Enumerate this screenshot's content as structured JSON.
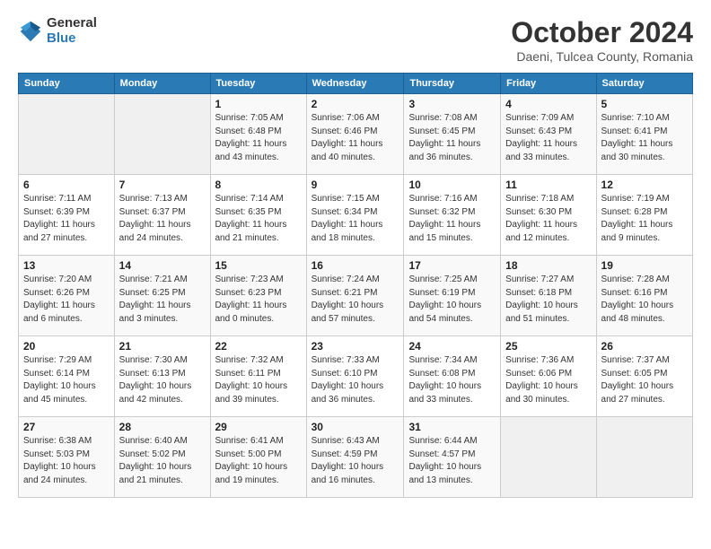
{
  "header": {
    "logo_general": "General",
    "logo_blue": "Blue",
    "month": "October 2024",
    "location": "Daeni, Tulcea County, Romania"
  },
  "weekdays": [
    "Sunday",
    "Monday",
    "Tuesday",
    "Wednesday",
    "Thursday",
    "Friday",
    "Saturday"
  ],
  "weeks": [
    [
      {
        "day": "",
        "sunrise": "",
        "sunset": "",
        "daylight": ""
      },
      {
        "day": "",
        "sunrise": "",
        "sunset": "",
        "daylight": ""
      },
      {
        "day": "1",
        "sunrise": "Sunrise: 7:05 AM",
        "sunset": "Sunset: 6:48 PM",
        "daylight": "Daylight: 11 hours and 43 minutes."
      },
      {
        "day": "2",
        "sunrise": "Sunrise: 7:06 AM",
        "sunset": "Sunset: 6:46 PM",
        "daylight": "Daylight: 11 hours and 40 minutes."
      },
      {
        "day": "3",
        "sunrise": "Sunrise: 7:08 AM",
        "sunset": "Sunset: 6:45 PM",
        "daylight": "Daylight: 11 hours and 36 minutes."
      },
      {
        "day": "4",
        "sunrise": "Sunrise: 7:09 AM",
        "sunset": "Sunset: 6:43 PM",
        "daylight": "Daylight: 11 hours and 33 minutes."
      },
      {
        "day": "5",
        "sunrise": "Sunrise: 7:10 AM",
        "sunset": "Sunset: 6:41 PM",
        "daylight": "Daylight: 11 hours and 30 minutes."
      }
    ],
    [
      {
        "day": "6",
        "sunrise": "Sunrise: 7:11 AM",
        "sunset": "Sunset: 6:39 PM",
        "daylight": "Daylight: 11 hours and 27 minutes."
      },
      {
        "day": "7",
        "sunrise": "Sunrise: 7:13 AM",
        "sunset": "Sunset: 6:37 PM",
        "daylight": "Daylight: 11 hours and 24 minutes."
      },
      {
        "day": "8",
        "sunrise": "Sunrise: 7:14 AM",
        "sunset": "Sunset: 6:35 PM",
        "daylight": "Daylight: 11 hours and 21 minutes."
      },
      {
        "day": "9",
        "sunrise": "Sunrise: 7:15 AM",
        "sunset": "Sunset: 6:34 PM",
        "daylight": "Daylight: 11 hours and 18 minutes."
      },
      {
        "day": "10",
        "sunrise": "Sunrise: 7:16 AM",
        "sunset": "Sunset: 6:32 PM",
        "daylight": "Daylight: 11 hours and 15 minutes."
      },
      {
        "day": "11",
        "sunrise": "Sunrise: 7:18 AM",
        "sunset": "Sunset: 6:30 PM",
        "daylight": "Daylight: 11 hours and 12 minutes."
      },
      {
        "day": "12",
        "sunrise": "Sunrise: 7:19 AM",
        "sunset": "Sunset: 6:28 PM",
        "daylight": "Daylight: 11 hours and 9 minutes."
      }
    ],
    [
      {
        "day": "13",
        "sunrise": "Sunrise: 7:20 AM",
        "sunset": "Sunset: 6:26 PM",
        "daylight": "Daylight: 11 hours and 6 minutes."
      },
      {
        "day": "14",
        "sunrise": "Sunrise: 7:21 AM",
        "sunset": "Sunset: 6:25 PM",
        "daylight": "Daylight: 11 hours and 3 minutes."
      },
      {
        "day": "15",
        "sunrise": "Sunrise: 7:23 AM",
        "sunset": "Sunset: 6:23 PM",
        "daylight": "Daylight: 11 hours and 0 minutes."
      },
      {
        "day": "16",
        "sunrise": "Sunrise: 7:24 AM",
        "sunset": "Sunset: 6:21 PM",
        "daylight": "Daylight: 10 hours and 57 minutes."
      },
      {
        "day": "17",
        "sunrise": "Sunrise: 7:25 AM",
        "sunset": "Sunset: 6:19 PM",
        "daylight": "Daylight: 10 hours and 54 minutes."
      },
      {
        "day": "18",
        "sunrise": "Sunrise: 7:27 AM",
        "sunset": "Sunset: 6:18 PM",
        "daylight": "Daylight: 10 hours and 51 minutes."
      },
      {
        "day": "19",
        "sunrise": "Sunrise: 7:28 AM",
        "sunset": "Sunset: 6:16 PM",
        "daylight": "Daylight: 10 hours and 48 minutes."
      }
    ],
    [
      {
        "day": "20",
        "sunrise": "Sunrise: 7:29 AM",
        "sunset": "Sunset: 6:14 PM",
        "daylight": "Daylight: 10 hours and 45 minutes."
      },
      {
        "day": "21",
        "sunrise": "Sunrise: 7:30 AM",
        "sunset": "Sunset: 6:13 PM",
        "daylight": "Daylight: 10 hours and 42 minutes."
      },
      {
        "day": "22",
        "sunrise": "Sunrise: 7:32 AM",
        "sunset": "Sunset: 6:11 PM",
        "daylight": "Daylight: 10 hours and 39 minutes."
      },
      {
        "day": "23",
        "sunrise": "Sunrise: 7:33 AM",
        "sunset": "Sunset: 6:10 PM",
        "daylight": "Daylight: 10 hours and 36 minutes."
      },
      {
        "day": "24",
        "sunrise": "Sunrise: 7:34 AM",
        "sunset": "Sunset: 6:08 PM",
        "daylight": "Daylight: 10 hours and 33 minutes."
      },
      {
        "day": "25",
        "sunrise": "Sunrise: 7:36 AM",
        "sunset": "Sunset: 6:06 PM",
        "daylight": "Daylight: 10 hours and 30 minutes."
      },
      {
        "day": "26",
        "sunrise": "Sunrise: 7:37 AM",
        "sunset": "Sunset: 6:05 PM",
        "daylight": "Daylight: 10 hours and 27 minutes."
      }
    ],
    [
      {
        "day": "27",
        "sunrise": "Sunrise: 6:38 AM",
        "sunset": "Sunset: 5:03 PM",
        "daylight": "Daylight: 10 hours and 24 minutes."
      },
      {
        "day": "28",
        "sunrise": "Sunrise: 6:40 AM",
        "sunset": "Sunset: 5:02 PM",
        "daylight": "Daylight: 10 hours and 21 minutes."
      },
      {
        "day": "29",
        "sunrise": "Sunrise: 6:41 AM",
        "sunset": "Sunset: 5:00 PM",
        "daylight": "Daylight: 10 hours and 19 minutes."
      },
      {
        "day": "30",
        "sunrise": "Sunrise: 6:43 AM",
        "sunset": "Sunset: 4:59 PM",
        "daylight": "Daylight: 10 hours and 16 minutes."
      },
      {
        "day": "31",
        "sunrise": "Sunrise: 6:44 AM",
        "sunset": "Sunset: 4:57 PM",
        "daylight": "Daylight: 10 hours and 13 minutes."
      },
      {
        "day": "",
        "sunrise": "",
        "sunset": "",
        "daylight": ""
      },
      {
        "day": "",
        "sunrise": "",
        "sunset": "",
        "daylight": ""
      }
    ]
  ]
}
